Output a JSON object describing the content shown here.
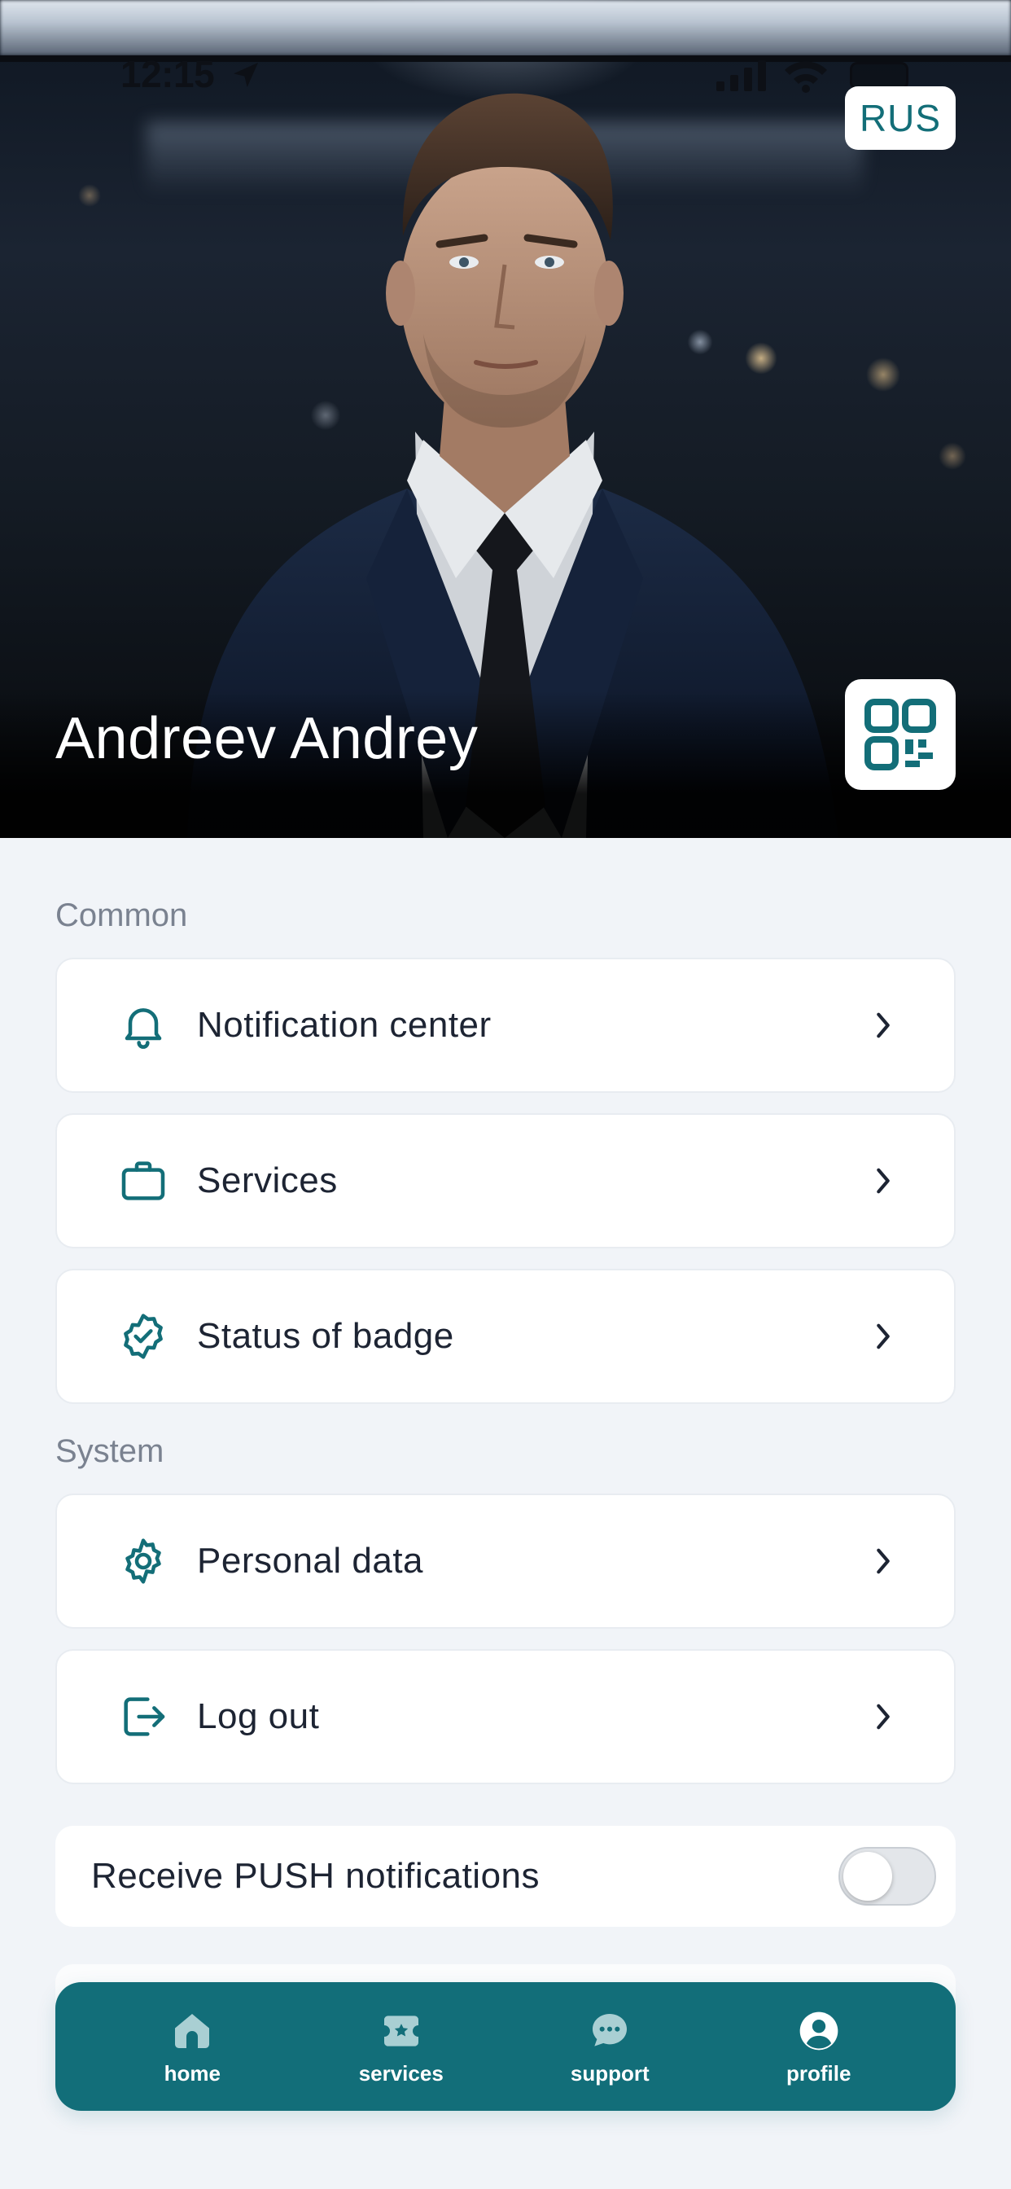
{
  "status_bar": {
    "time": "12:15"
  },
  "header": {
    "language_button": "RUS",
    "user_name": "Andreev Andrey",
    "qr_icon": "qr-code-icon"
  },
  "sections": {
    "common_label": "Common",
    "system_label": "System"
  },
  "common_items": [
    {
      "label": "Notification center",
      "icon": "bell-icon"
    },
    {
      "label": "Services",
      "icon": "briefcase-icon"
    },
    {
      "label": "Status of badge",
      "icon": "verified-badge-icon"
    }
  ],
  "system_items": [
    {
      "label": "Personal data",
      "icon": "gear-icon"
    },
    {
      "label": "Log out",
      "icon": "logout-icon"
    }
  ],
  "push": {
    "label": "Receive PUSH notifications",
    "enabled": false
  },
  "nav": {
    "items": [
      {
        "label": "home",
        "icon": "home-icon",
        "active": false
      },
      {
        "label": "services",
        "icon": "ticket-star-icon",
        "active": false
      },
      {
        "label": "support",
        "icon": "chat-bubble-icon",
        "active": false
      },
      {
        "label": "profile",
        "icon": "user-circle-icon",
        "active": true
      }
    ]
  },
  "colors": {
    "accent": "#126e79",
    "background": "#f1f4f8",
    "card": "#ffffff",
    "text": "#1d2433",
    "muted": "#7a8290"
  }
}
